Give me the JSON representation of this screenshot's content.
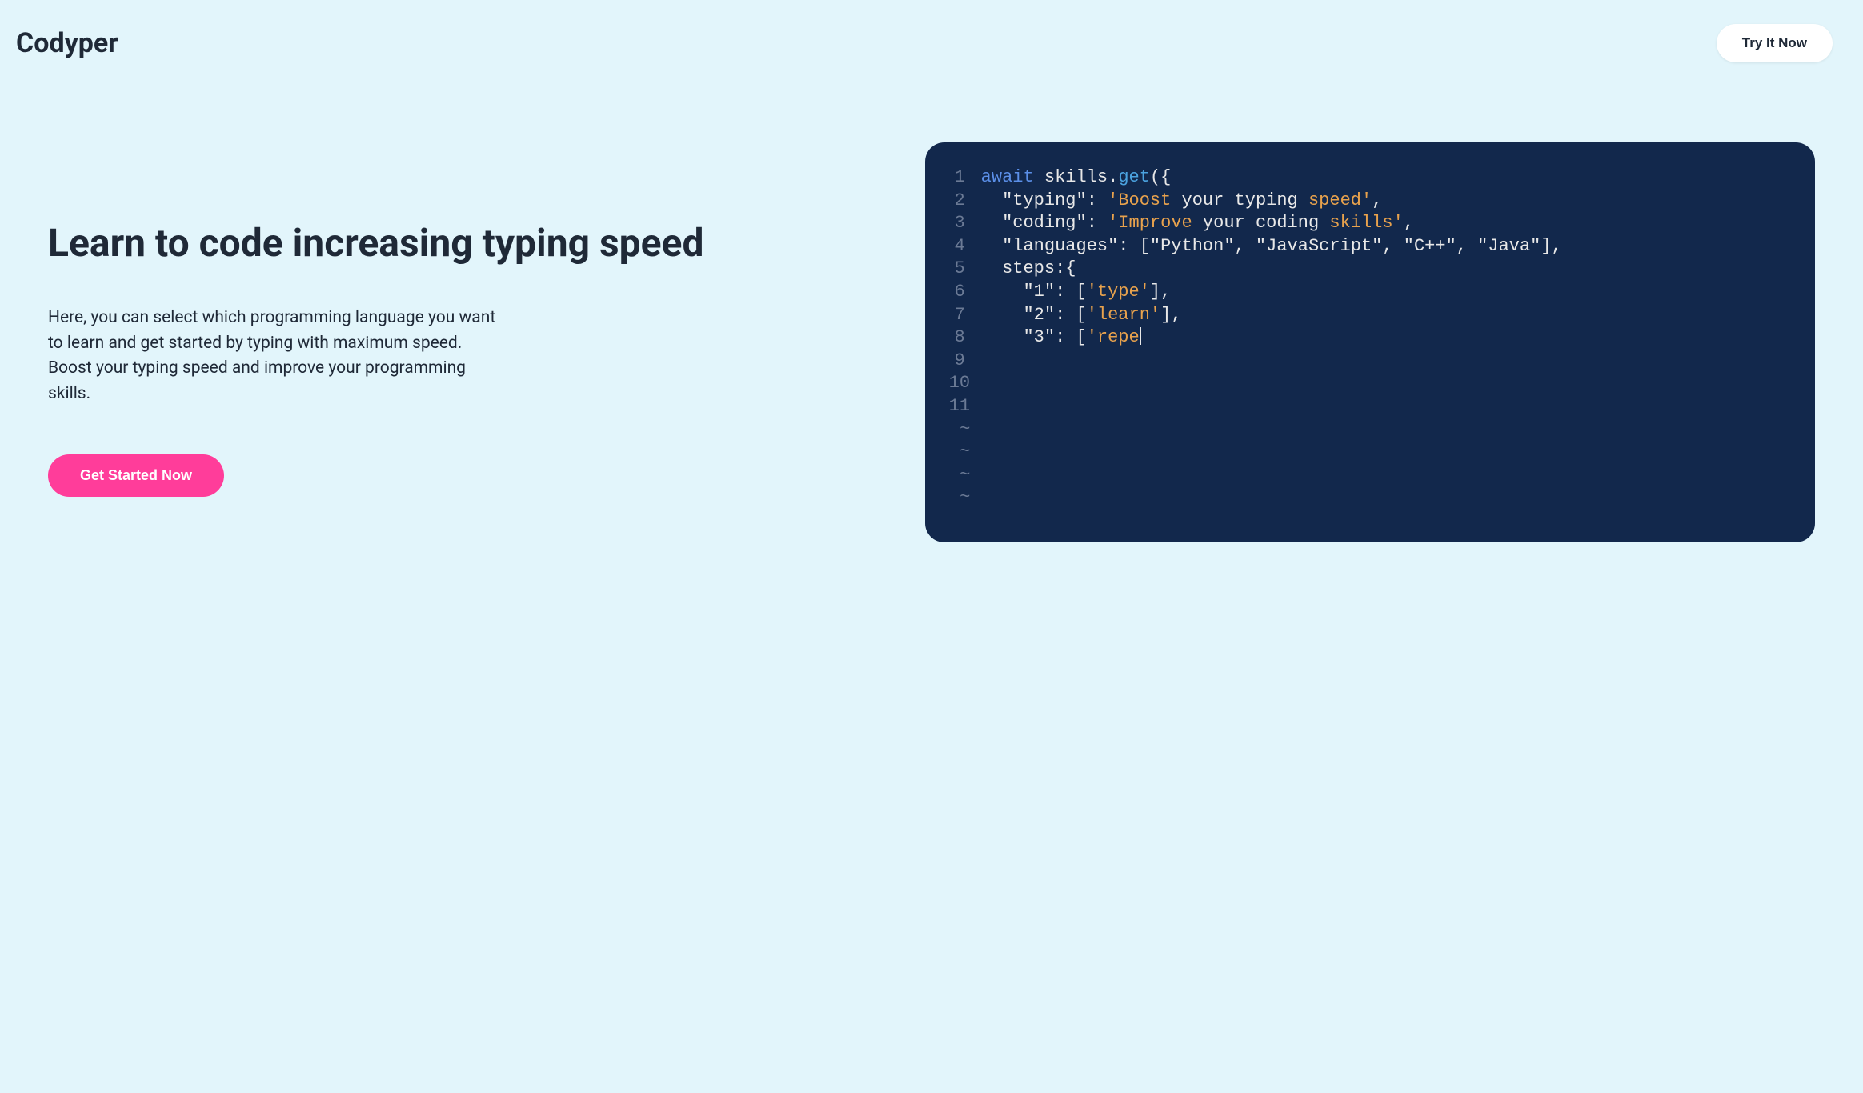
{
  "header": {
    "logo": "Codyper",
    "try_button": "Try It Now"
  },
  "hero": {
    "title": "Learn to code increasing typing speed",
    "description": "Here, you can select which programming language you want to learn and get started by typing with maximum speed. Boost your typing speed and improve your programming skills.",
    "cta_button": "Get Started Now"
  },
  "code": {
    "lines": [
      {
        "num": "1",
        "tokens": [
          {
            "t": "await",
            "c": "kw-await"
          },
          {
            "t": " skills.",
            "c": "kw-text"
          },
          {
            "t": "get",
            "c": "kw-method"
          },
          {
            "t": "({",
            "c": "kw-text"
          }
        ]
      },
      {
        "num": "2",
        "tokens": [
          {
            "t": "  \"typing\": ",
            "c": "kw-text"
          },
          {
            "t": "'Boost",
            "c": "kw-string-orange"
          },
          {
            "t": " your typing ",
            "c": "kw-text"
          },
          {
            "t": "speed'",
            "c": "kw-string-orange"
          },
          {
            "t": ",",
            "c": "kw-text"
          }
        ]
      },
      {
        "num": "3",
        "tokens": [
          {
            "t": "  \"coding\": ",
            "c": "kw-text"
          },
          {
            "t": "'Improve",
            "c": "kw-string-orange"
          },
          {
            "t": " your coding ",
            "c": "kw-text"
          },
          {
            "t": "skills'",
            "c": "kw-string-orange"
          },
          {
            "t": ",",
            "c": "kw-text"
          }
        ]
      },
      {
        "num": "4",
        "tokens": [
          {
            "t": "  \"languages\": [\"Python\", \"JavaScript\", \"C++\", \"Java\"],",
            "c": "kw-text"
          }
        ]
      },
      {
        "num": "5",
        "tokens": [
          {
            "t": "  steps:{",
            "c": "kw-text"
          }
        ]
      },
      {
        "num": "6",
        "tokens": [
          {
            "t": "    \"1\": [",
            "c": "kw-text"
          },
          {
            "t": "'type'",
            "c": "kw-string-orange"
          },
          {
            "t": "],",
            "c": "kw-text"
          }
        ]
      },
      {
        "num": "7",
        "tokens": [
          {
            "t": "    \"2\": [",
            "c": "kw-text"
          },
          {
            "t": "'learn'",
            "c": "kw-string-orange"
          },
          {
            "t": "],",
            "c": "kw-text"
          }
        ]
      },
      {
        "num": "8",
        "tokens": [
          {
            "t": "    \"3\": [",
            "c": "kw-text"
          },
          {
            "t": "'repe",
            "c": "kw-string-orange"
          }
        ],
        "cursor": true
      },
      {
        "num": "9",
        "tokens": []
      },
      {
        "num": "10",
        "tokens": []
      },
      {
        "num": "11",
        "tokens": []
      }
    ],
    "tilde_count": 4,
    "tilde": "~"
  }
}
